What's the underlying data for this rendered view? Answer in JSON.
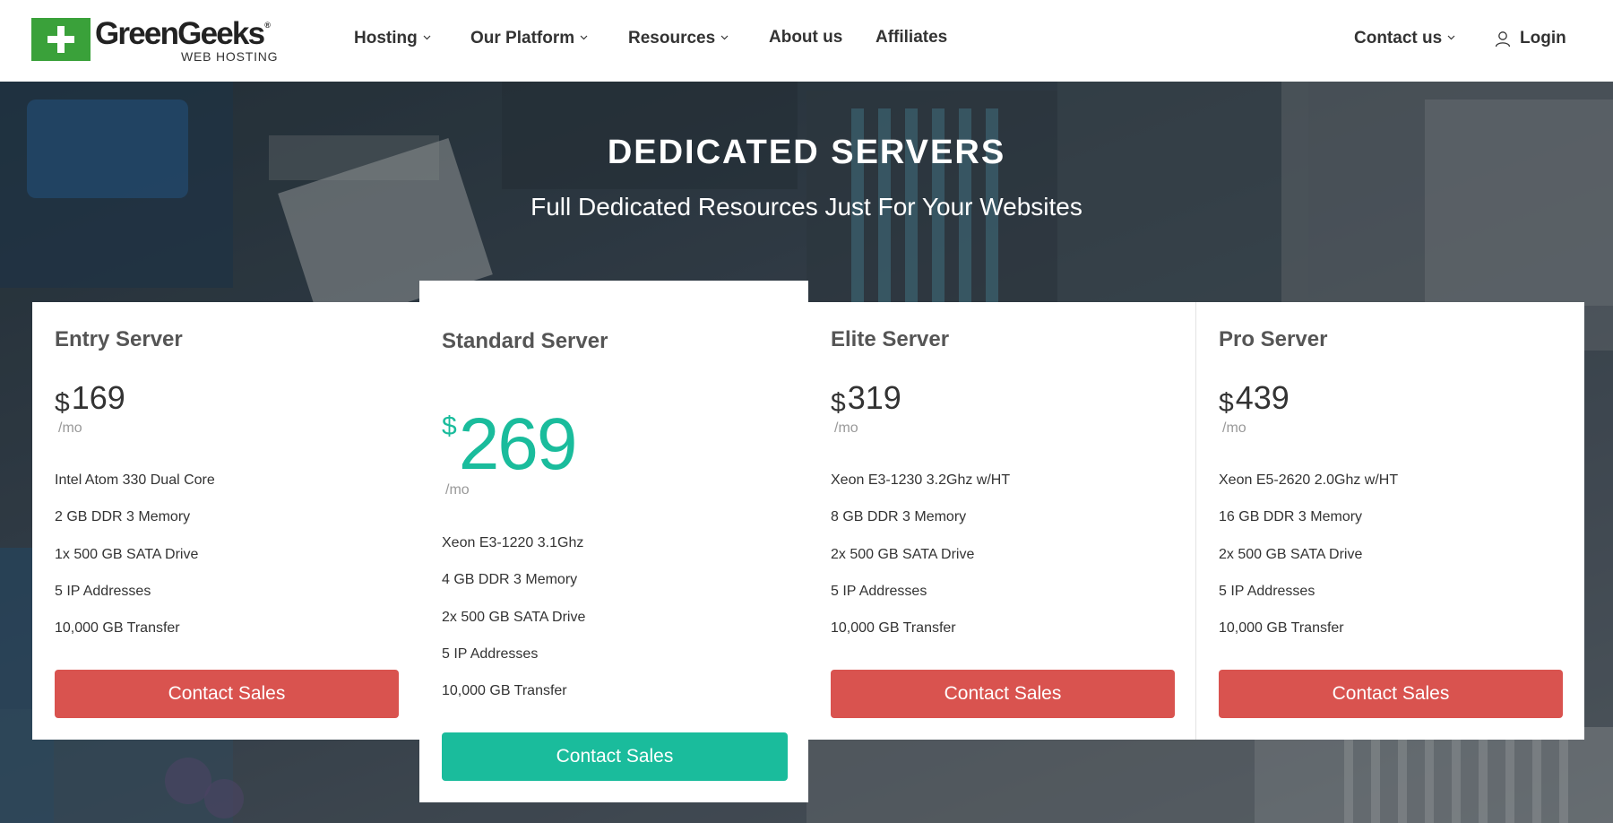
{
  "header": {
    "logo": {
      "name": "GreenGeeks",
      "reg": "®",
      "sub": "WEB HOSTING"
    },
    "nav": [
      {
        "label": "Hosting",
        "dropdown": true
      },
      {
        "label": "Our Platform",
        "dropdown": true
      },
      {
        "label": "Resources",
        "dropdown": true
      },
      {
        "label": "About us",
        "dropdown": false
      },
      {
        "label": "Affiliates",
        "dropdown": false
      }
    ],
    "contact": {
      "label": "Contact us",
      "dropdown": true
    },
    "login": {
      "label": "Login",
      "icon": "user-icon"
    }
  },
  "hero": {
    "title": "DEDICATED SERVERS",
    "subtitle": "Full Dedicated Resources Just For Your Websites"
  },
  "plans": [
    {
      "name": "Entry Server",
      "currency": "$",
      "price": "169",
      "period": "/mo",
      "features": [
        "Intel Atom 330 Dual Core",
        "2 GB DDR 3 Memory",
        "1x 500 GB SATA Drive",
        "5 IP Addresses",
        "10,000 GB Transfer"
      ],
      "button": "Contact Sales"
    },
    {
      "name": "Standard Server",
      "currency": "$",
      "price": "269",
      "period": "/mo",
      "features": [
        "Xeon E3-1220 3.1Ghz",
        "4 GB DDR 3 Memory",
        "2x 500 GB SATA Drive",
        "5 IP Addresses",
        "10,000 GB Transfer"
      ],
      "button": "Contact Sales",
      "featured": true
    },
    {
      "name": "Elite Server",
      "currency": "$",
      "price": "319",
      "period": "/mo",
      "features": [
        "Xeon E3-1230 3.2Ghz w/HT",
        "8 GB DDR 3 Memory",
        "2x 500 GB SATA Drive",
        "5 IP Addresses",
        "10,000 GB Transfer"
      ],
      "button": "Contact Sales"
    },
    {
      "name": "Pro Server",
      "currency": "$",
      "price": "439",
      "period": "/mo",
      "features": [
        "Xeon E5-2620 2.0Ghz w/HT",
        "16 GB DDR 3 Memory",
        "2x 500 GB SATA Drive",
        "5 IP Addresses",
        "10,000 GB Transfer"
      ],
      "button": "Contact Sales"
    }
  ],
  "colors": {
    "brand_green": "#3aa13a",
    "accent_teal": "#1abc9c",
    "button_red": "#d9534f"
  }
}
